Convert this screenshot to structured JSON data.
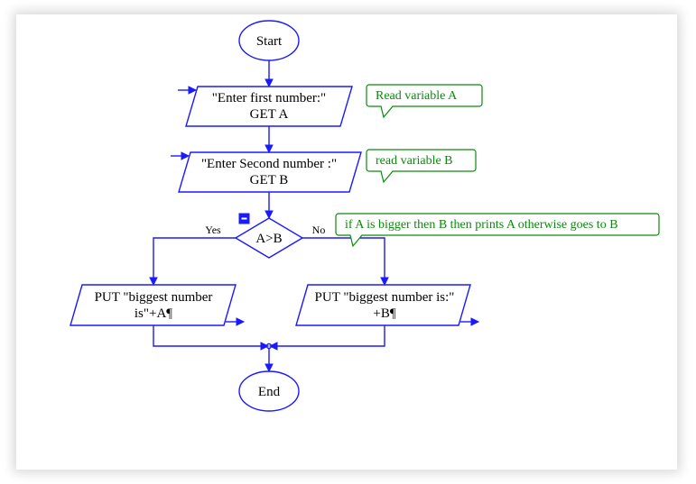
{
  "flowchart": {
    "start": "Start",
    "end": "End",
    "input_a": {
      "line1": "\"Enter first number:\"",
      "line2": "GET A"
    },
    "input_b": {
      "line1": "\"Enter Second number :\"",
      "line2": "GET B"
    },
    "decision": {
      "condition": "A>B",
      "yes": "Yes",
      "no": "No"
    },
    "output_a": {
      "line1": "PUT \"biggest number",
      "line2": "is\"+A¶"
    },
    "output_b": {
      "line1": "PUT \"biggest number is:\"",
      "line2": "+B¶"
    }
  },
  "annotations": {
    "read_a": "Read variable A",
    "read_b": "read variable B",
    "decision_note": "if A is bigger then B then prints A otherwise goes to B"
  }
}
